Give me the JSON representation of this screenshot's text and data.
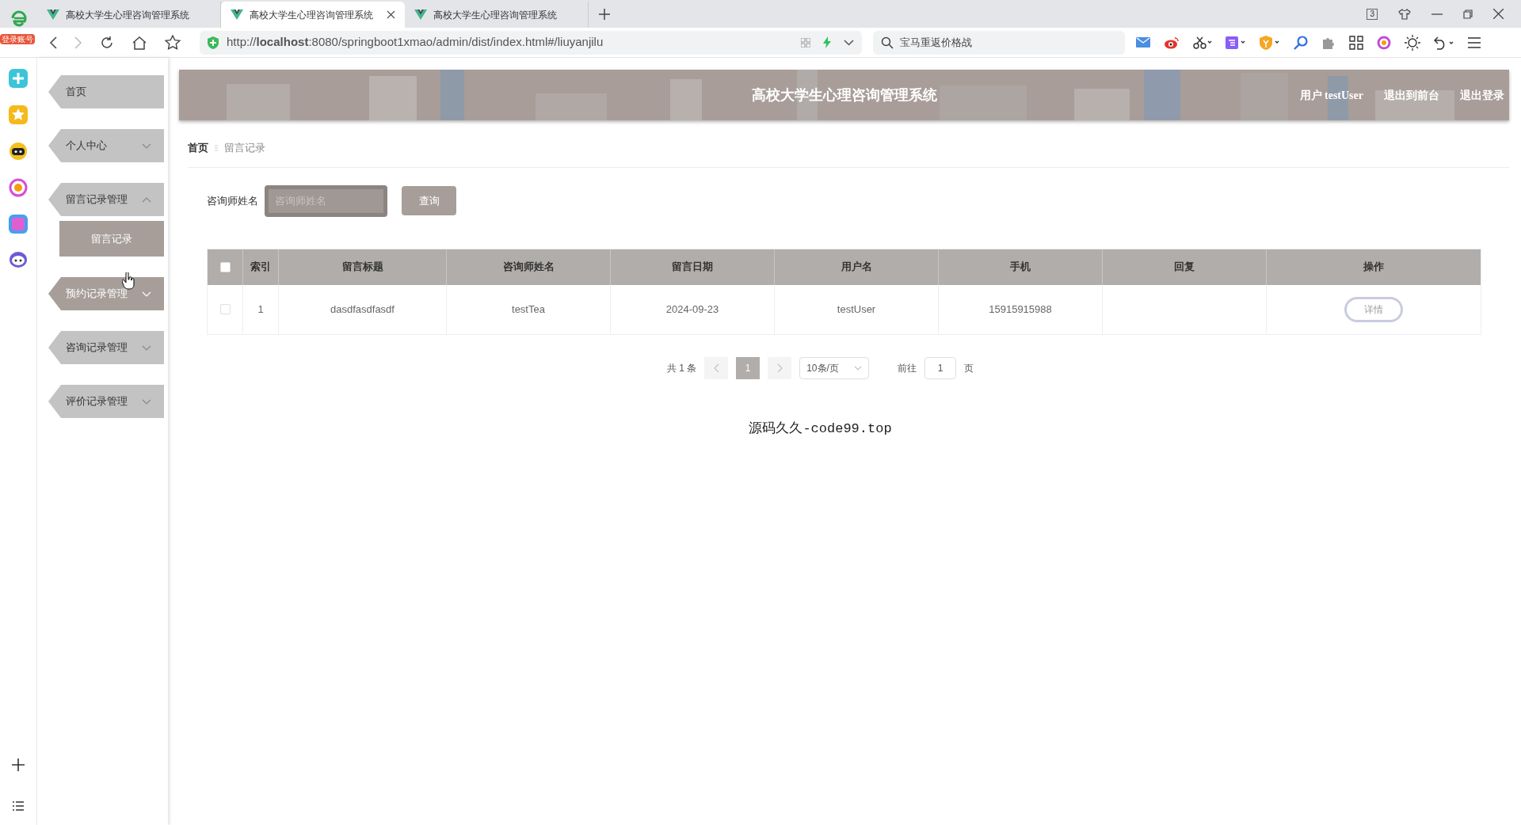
{
  "browser": {
    "badge": "登录账号",
    "tabs": [
      {
        "title": "高校大学生心理咨询管理系统",
        "selected": false
      },
      {
        "title": "高校大学生心理咨询管理系统",
        "selected": true
      },
      {
        "title": "高校大学生心理咨询管理系统",
        "selected": false
      }
    ],
    "tab_count": "3",
    "url": "http://**localhost**:8080/springboot1xmao/admin/dist/index.html#/liuyanjilu",
    "search": {
      "placeholder": "宝马重返价格战"
    }
  },
  "sidebar": {
    "items": [
      {
        "label": "首页",
        "kind": "link",
        "hovered": false
      },
      {
        "label": "个人中心",
        "kind": "submenu",
        "expanded": false,
        "hovered": false
      },
      {
        "label": "留言记录管理",
        "kind": "submenu",
        "expanded": true,
        "hovered": false,
        "children": [
          {
            "label": "留言记录",
            "selected": true
          }
        ]
      },
      {
        "label": "预约记录管理",
        "kind": "submenu",
        "expanded": false,
        "hovered": true
      },
      {
        "label": "咨询记录管理",
        "kind": "submenu",
        "expanded": false,
        "hovered": false
      },
      {
        "label": "评价记录管理",
        "kind": "submenu",
        "expanded": false,
        "hovered": false
      }
    ]
  },
  "header": {
    "title": "高校大学生心理咨询管理系统",
    "user": "用户 testUser",
    "links": [
      "退出到前台",
      "退出登录"
    ]
  },
  "breadcrumb": [
    "首页",
    "留言记录"
  ],
  "search": {
    "label": "咨询师姓名",
    "placeholder": "咨询师姓名",
    "button": "查询"
  },
  "table": {
    "header_checked": false,
    "columns": [
      "索引",
      "留言标题",
      "咨询师姓名",
      "留言日期",
      "用户名",
      "手机",
      "回复",
      "操作"
    ],
    "rows": [
      {
        "checked": false,
        "index": "1",
        "title": "dasdfasdfasdf",
        "counselor": "testTea",
        "date": "2024-09-23",
        "user": "testUser",
        "phone": "15915915988",
        "action": "详情"
      }
    ]
  },
  "pagination": {
    "total": "共 1 条",
    "pages": [
      {
        "label": "1",
        "selected": true
      }
    ],
    "page_size": "10条/页",
    "goto_label": "前往",
    "goto_value": "1",
    "goto_suffix": "页"
  },
  "footer": "源码久久-code99.top"
}
